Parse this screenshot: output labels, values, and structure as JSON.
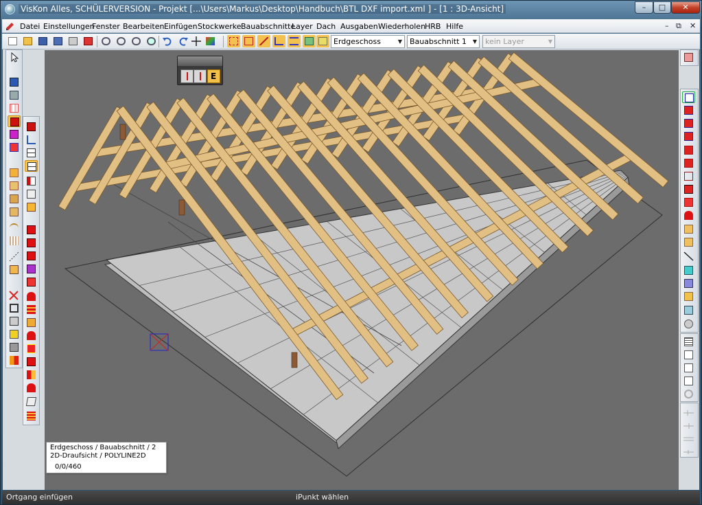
{
  "window": {
    "title": "VisKon Alles, SCHÜLERVERSION - Projekt [...\\Users\\Markus\\Desktop\\Handbuch\\BTL DXF import.xml ] - [1 : 3D-Ansicht]",
    "minimize": "–",
    "maximize": "□",
    "close": "✕"
  },
  "menu": {
    "items": [
      "Datei",
      "Einstellungen",
      "Fenster",
      "Bearbeiten",
      "Einfügen",
      "Stockwerke",
      "Bauabschnitte",
      "Layer",
      "Dach",
      "Ausgaben",
      "Wiederholen",
      "HRB",
      "Hilfe"
    ],
    "mdi_min": "–",
    "mdi_restore": "⧉",
    "mdi_close": "✕"
  },
  "toolbar": {
    "floor_select": "Erdgeschoss",
    "section_select": "Bauabschnitt 1",
    "layer_select": "kein Layer"
  },
  "palette": {
    "active": "E"
  },
  "info_box": {
    "title": "Erdgeschoss / Bauabschnitt / 2 2D-Draufsicht / POLYLINE2D",
    "coords": "0/0/460"
  },
  "status": {
    "left": "Ortgang einfügen",
    "mid": "iPunkt wählen"
  },
  "colors": {
    "viewport_bg": "#6c6c6c",
    "timber": "#e2bf83",
    "timber_edge": "#7a5a2c",
    "slab": "#c8c8c8",
    "accent": "#f2c04b"
  }
}
